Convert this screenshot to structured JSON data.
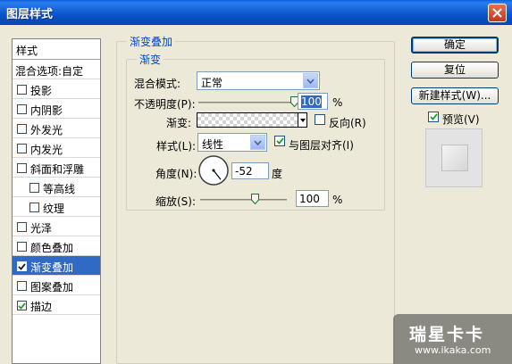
{
  "window": {
    "title": "图层样式"
  },
  "style_list": {
    "header": "样式",
    "blend_options": "混合选项:自定",
    "items": [
      {
        "label": "投影",
        "checked": false,
        "sub": false,
        "selected": false
      },
      {
        "label": "内阴影",
        "checked": false,
        "sub": false,
        "selected": false
      },
      {
        "label": "外发光",
        "checked": false,
        "sub": false,
        "selected": false
      },
      {
        "label": "内发光",
        "checked": false,
        "sub": false,
        "selected": false
      },
      {
        "label": "斜面和浮雕",
        "checked": false,
        "sub": false,
        "selected": false
      },
      {
        "label": "等高线",
        "checked": false,
        "sub": true,
        "selected": false
      },
      {
        "label": "纹理",
        "checked": false,
        "sub": true,
        "selected": false
      },
      {
        "label": "光泽",
        "checked": false,
        "sub": false,
        "selected": false
      },
      {
        "label": "颜色叠加",
        "checked": false,
        "sub": false,
        "selected": false
      },
      {
        "label": "渐变叠加",
        "checked": true,
        "sub": false,
        "selected": true
      },
      {
        "label": "图案叠加",
        "checked": false,
        "sub": false,
        "selected": false
      },
      {
        "label": "描边",
        "checked": true,
        "sub": false,
        "selected": false
      }
    ]
  },
  "panel": {
    "outer_title": "渐变叠加",
    "inner_title": "渐变",
    "blend_mode_label": "混合模式:",
    "blend_mode_value": "正常",
    "opacity_label": "不透明度(P):",
    "opacity_value": "100",
    "opacity_unit": "%",
    "opacity_slider_level": 1.0,
    "gradient_label": "渐变:",
    "reverse_label": "反向(R)",
    "reverse_checked": false,
    "style_label": "样式(L):",
    "style_value": "线性",
    "align_label": "与图层对齐(I)",
    "align_checked": true,
    "angle_label": "角度(N):",
    "angle_value": "-52",
    "angle_unit": "度",
    "scale_label": "缩放(S):",
    "scale_value": "100",
    "scale_unit": "%",
    "scale_slider_level": 0.66
  },
  "buttons": {
    "ok": "确定",
    "reset": "复位",
    "new_style": "新建样式(W)...",
    "preview_label": "预览(V)",
    "preview_checked": true
  },
  "watermark": {
    "brand": "瑞星卡卡",
    "url": "www.ikaka.com"
  },
  "colors": {
    "titlebar": "#0a53c8",
    "selection": "#316ac5",
    "group_title": "#0046d5"
  }
}
